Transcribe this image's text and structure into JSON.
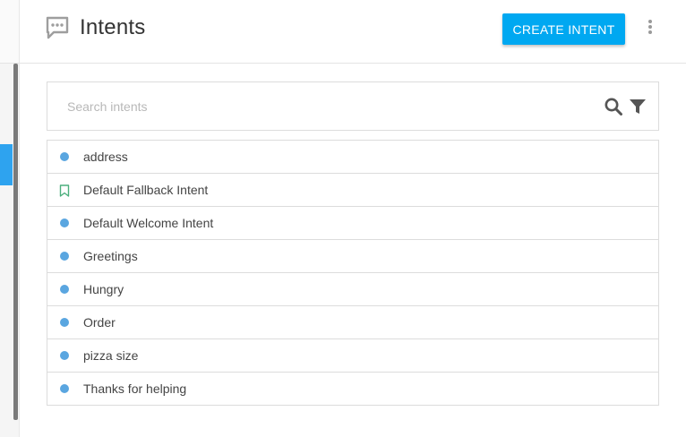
{
  "header": {
    "title": "Intents",
    "create_label": "CREATE INTENT",
    "title_icon": "chat-bubble-icon",
    "more_icon": "more-vertical-icon"
  },
  "search": {
    "placeholder": "Search intents",
    "value": "",
    "search_icon": "search-icon",
    "filter_icon": "filter-icon"
  },
  "intents": [
    {
      "label": "address",
      "marker": "dot"
    },
    {
      "label": "Default Fallback Intent",
      "marker": "bookmark"
    },
    {
      "label": "Default Welcome Intent",
      "marker": "dot"
    },
    {
      "label": "Greetings",
      "marker": "dot"
    },
    {
      "label": "Hungry",
      "marker": "dot"
    },
    {
      "label": "Order",
      "marker": "dot"
    },
    {
      "label": "pizza size",
      "marker": "dot"
    },
    {
      "label": "Thanks for helping",
      "marker": "dot"
    }
  ],
  "colors": {
    "accent": "#00a8f1",
    "dot": "#5aa6e0",
    "bookmark": "#4caf7d",
    "sidebar_active": "#2ea3ef"
  }
}
